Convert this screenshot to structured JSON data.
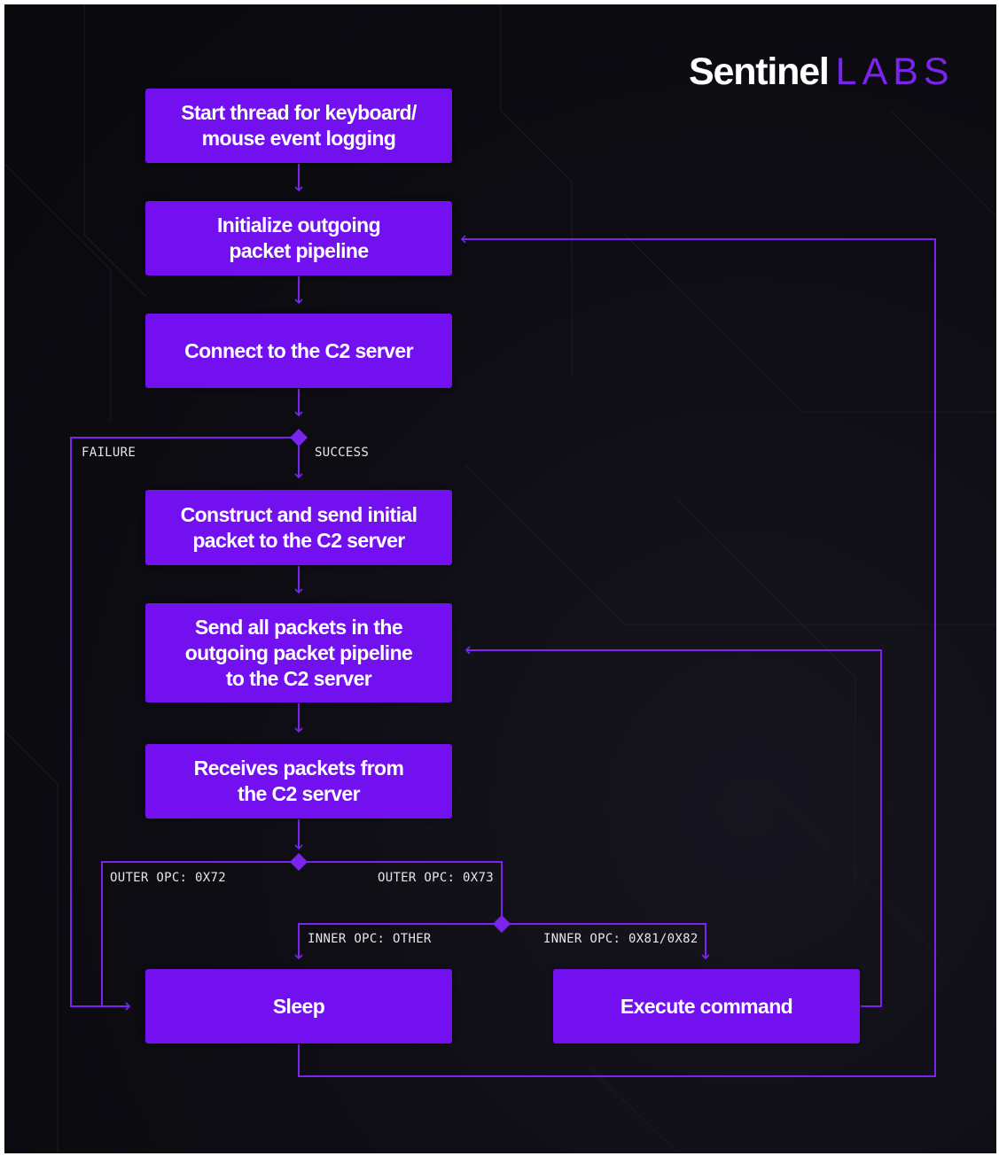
{
  "logo": {
    "primary": "Sentinel",
    "secondary": "LABS"
  },
  "steps": {
    "start_thread": "Start thread for keyboard/\nmouse event logging",
    "init_pipeline": "Initialize outgoing\npacket pipeline",
    "connect": "Connect to the C2 server",
    "construct_send": "Construct and send initial\npacket to the C2 server",
    "send_all": "Send all packets in the\noutgoing packet pipeline\nto the C2 server",
    "receive": "Receives packets from\nthe C2 server",
    "sleep": "Sleep",
    "execute": "Execute command"
  },
  "labels": {
    "failure": "FAILURE",
    "success": "SUCCESS",
    "outer_72": "OUTER OPC: 0X72",
    "outer_73": "OUTER OPC: 0X73",
    "inner_other": "INNER OPC: OTHER",
    "inner_81_82": "INNER OPC: 0X81/0X82"
  },
  "colors": {
    "box": "#7310f0",
    "line": "#7a24ee",
    "background": "#0d0c12",
    "text": "#ffffff"
  }
}
